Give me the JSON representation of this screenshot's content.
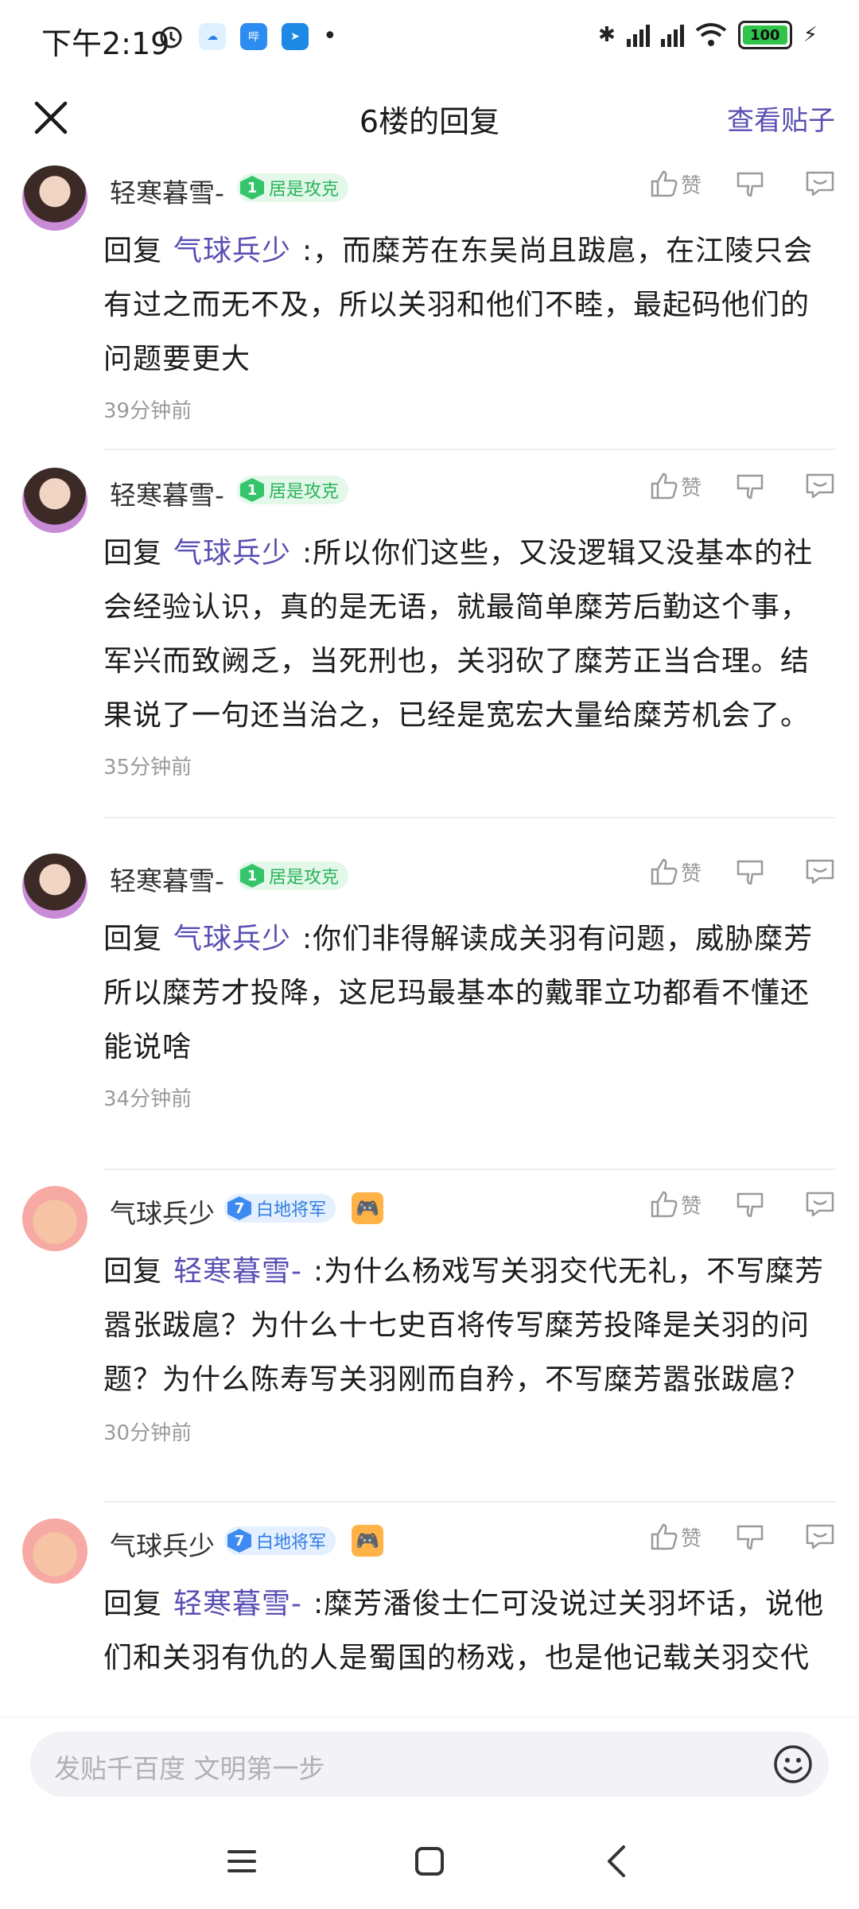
{
  "status": {
    "time": "下午2:19",
    "battery": "100",
    "network_label": "HD"
  },
  "header": {
    "title": "6楼的回复",
    "view_post": "查看贴子"
  },
  "replies": [
    {
      "username": "轻寒暮雪-",
      "level": "1",
      "badge": "居是攻克",
      "reply_prefix": "回复",
      "mention": "气球兵少",
      "text": ":，而糜芳在东吴尚且跋扈，在江陵只会有过之而无不及，所以关羽和他们不睦，最起码他们的问题要更大",
      "time": "39分钟前",
      "like_label": "赞"
    },
    {
      "username": "轻寒暮雪-",
      "level": "1",
      "badge": "居是攻克",
      "reply_prefix": "回复",
      "mention": "气球兵少",
      "text": ":所以你们这些，又没逻辑又没基本的社会经验认识，真的是无语，就最简单糜芳后勤这个事，军兴而致阙乏，当死刑也，关羽砍了糜芳正当合理。结果说了一句还当治之，已经是宽宏大量给糜芳机会了。",
      "time": "35分钟前",
      "like_label": "赞"
    },
    {
      "username": "轻寒暮雪-",
      "level": "1",
      "badge": "居是攻克",
      "reply_prefix": "回复",
      "mention": "气球兵少",
      "text": ":你们非得解读成关羽有问题，威胁糜芳所以糜芳才投降，这尼玛最基本的戴罪立功都看不懂还能说啥",
      "time": "34分钟前",
      "like_label": "赞"
    },
    {
      "username": "气球兵少",
      "level": "7",
      "badge": "白地将军",
      "reply_prefix": "回复",
      "mention": "轻寒暮雪-",
      "text": ":为什么杨戏写关羽交代无礼，不写糜芳嚣张跋扈？为什么十七史百将传写糜芳投降是关羽的问题？为什么陈寿写关羽刚而自矜，不写糜芳嚣张跋扈？",
      "time": "30分钟前",
      "like_label": "赞"
    },
    {
      "username": "气球兵少",
      "level": "7",
      "badge": "白地将军",
      "reply_prefix": "回复",
      "mention": "轻寒暮雪-",
      "text": ":糜芳潘俊士仁可没说过关羽坏话，说他们和关羽有仇的人是蜀国的杨戏，也是他记载关羽交代",
      "time": "",
      "like_label": "赞"
    }
  ],
  "input": {
    "placeholder": "发贴千百度 文明第一步"
  },
  "colors": {
    "accent": "#5a4fb3",
    "badge_green": "#36c46a",
    "badge_blue": "#3d8af0"
  }
}
